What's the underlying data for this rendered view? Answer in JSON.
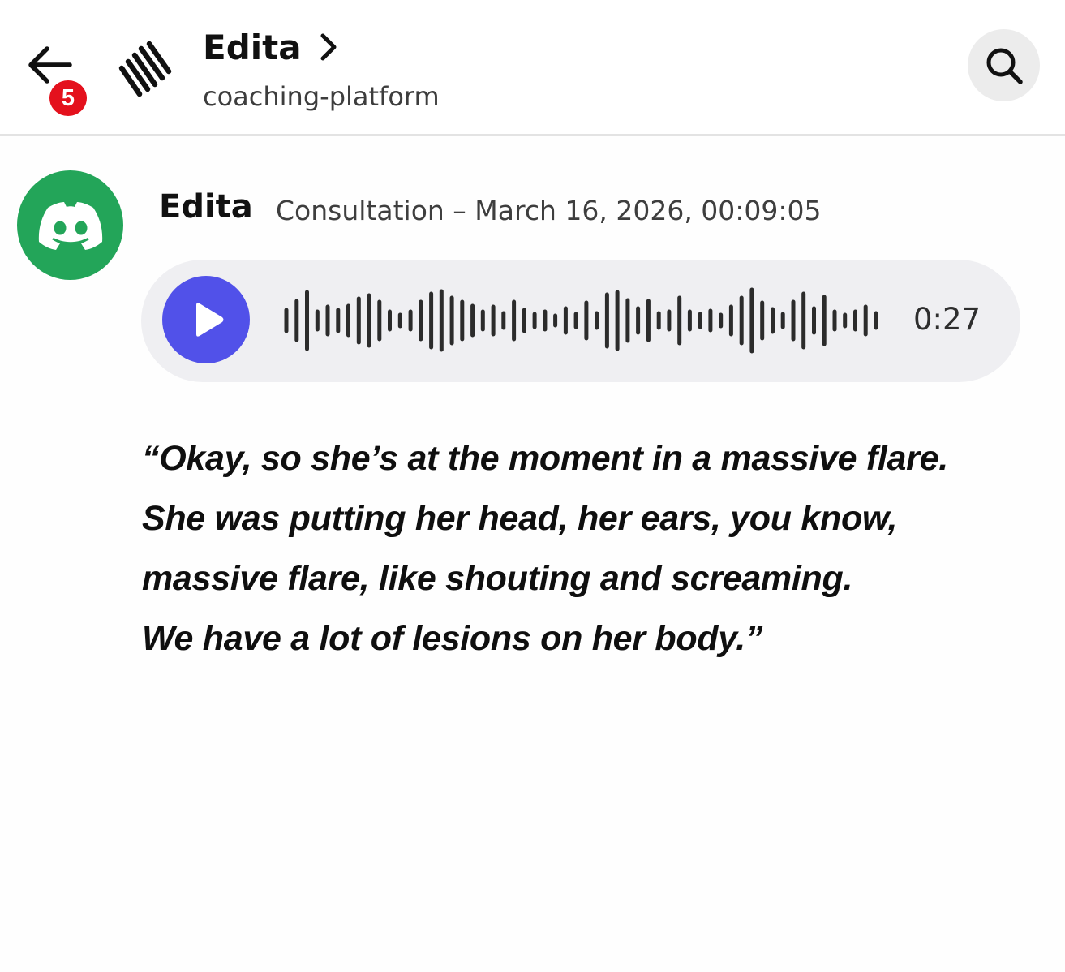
{
  "header": {
    "unread_count": "5",
    "title": "Edita",
    "subtitle": "coaching-platform",
    "icons": {
      "back": "back-arrow-icon",
      "channel": "channel-logo-icon",
      "title_chevron": "chevron-right-icon",
      "search": "search-icon"
    }
  },
  "message": {
    "avatar_icon": "discord-logo-icon",
    "avatar_color": "#23a559",
    "author": "Edita",
    "timestamp": "Consultation – March 16, 2026, 00:09:05",
    "voice": {
      "play_icon": "play-icon",
      "accent_color": "#5151e9",
      "duration": "0:27"
    },
    "transcript_lines": [
      "“Okay, so she’s at the moment in a massive flare.",
      "She was putting her head, her ears, you know,",
      "massive flare, like shouting and screaming.",
      "We have a lot of lesions on her body.”"
    ]
  }
}
